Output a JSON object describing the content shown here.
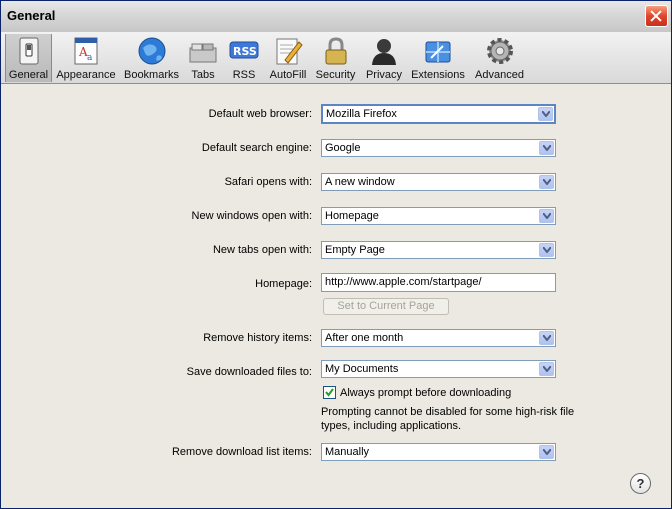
{
  "window": {
    "title": "General"
  },
  "toolbar": {
    "items": [
      {
        "label": "General",
        "icon": "switch-icon"
      },
      {
        "label": "Appearance",
        "icon": "appearance-icon"
      },
      {
        "label": "Bookmarks",
        "icon": "globe-icon"
      },
      {
        "label": "Tabs",
        "icon": "tabs-icon"
      },
      {
        "label": "RSS",
        "icon": "rss-icon",
        "badge": "RSS"
      },
      {
        "label": "AutoFill",
        "icon": "pencil-icon"
      },
      {
        "label": "Security",
        "icon": "lock-icon"
      },
      {
        "label": "Privacy",
        "icon": "person-icon"
      },
      {
        "label": "Extensions",
        "icon": "puzzle-icon"
      },
      {
        "label": "Advanced",
        "icon": "gear-icon"
      }
    ],
    "selected": "General"
  },
  "settings": {
    "default_browser": {
      "label": "Default web browser:",
      "value": "Mozilla Firefox"
    },
    "search_engine": {
      "label": "Default search engine:",
      "value": "Google"
    },
    "safari_opens": {
      "label": "Safari opens with:",
      "value": "A new window"
    },
    "new_windows": {
      "label": "New windows open with:",
      "value": "Homepage"
    },
    "new_tabs": {
      "label": "New tabs open with:",
      "value": "Empty Page"
    },
    "homepage": {
      "label": "Homepage:",
      "value": "http://www.apple.com/startpage/",
      "button": "Set to Current Page"
    },
    "remove_history": {
      "label": "Remove history items:",
      "value": "After one month"
    },
    "save_downloads": {
      "label": "Save downloaded files to:",
      "value": "My Documents"
    },
    "prompt_download": {
      "label": "Always prompt before downloading",
      "checked": true,
      "note": "Prompting cannot be disabled for some high-risk file types, including applications."
    },
    "remove_download_list": {
      "label": "Remove download list items:",
      "value": "Manually"
    }
  },
  "help": {
    "label": "?"
  },
  "colors": {
    "accent": "#5a86c6",
    "close": "#e0462a"
  }
}
